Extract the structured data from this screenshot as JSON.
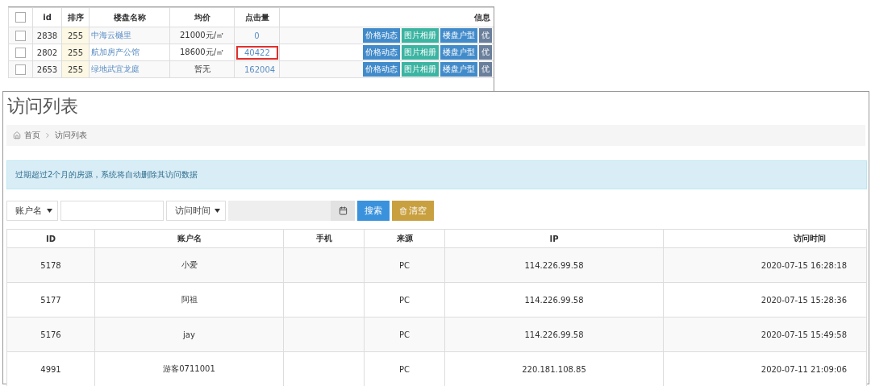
{
  "background_table": {
    "select_all": {
      "checked": false
    },
    "columns": [
      "id",
      "排序",
      "楼盘名称",
      "均价",
      "点击量",
      "信息"
    ],
    "rows": [
      {
        "checked": false,
        "id": "2838",
        "sort": "255",
        "name": "中海云樾里",
        "price": "21000元/㎡",
        "clicks": "0",
        "highlighted": false,
        "actions": [
          {
            "label": "价格动态",
            "color": "#428bca"
          },
          {
            "label": "图片相册",
            "color": "#3cb4a2"
          },
          {
            "label": "楼盘户型",
            "color": "#428bca"
          },
          {
            "label": "优",
            "color": "#6a7f9b"
          }
        ]
      },
      {
        "checked": false,
        "id": "2802",
        "sort": "255",
        "name": "航加房产公馆",
        "price": "18600元/㎡",
        "clicks": "40422",
        "highlighted": true,
        "actions": [
          {
            "label": "价格动态",
            "color": "#428bca"
          },
          {
            "label": "图片相册",
            "color": "#3cb4a2"
          },
          {
            "label": "楼盘户型",
            "color": "#428bca"
          },
          {
            "label": "优",
            "color": "#6a7f9b"
          }
        ]
      },
      {
        "checked": false,
        "id": "2653",
        "sort": "255",
        "name": "绿地武宜龙庭",
        "price": "暂无",
        "clicks": "162004",
        "highlighted": false,
        "actions": [
          {
            "label": "价格动态",
            "color": "#428bca"
          },
          {
            "label": "图片相册",
            "color": "#3cb4a2"
          },
          {
            "label": "楼盘户型",
            "color": "#428bca"
          },
          {
            "label": "优",
            "color": "#6a7f9b"
          }
        ]
      }
    ]
  },
  "page": {
    "title": "访问列表",
    "breadcrumb": [
      {
        "label": "首页",
        "kind": "home"
      },
      {
        "label": "访问列表",
        "kind": "page"
      }
    ],
    "alert": "过期超过2个月的房源，系统将自动删除其访问数据",
    "filters": {
      "field_select": "账户名",
      "time_select": "访问时间"
    },
    "buttons": [
      {
        "label": "搜索",
        "kind": "search"
      },
      {
        "label": "清空",
        "kind": "clear"
      }
    ],
    "table": {
      "columns": [
        "ID",
        "账户名",
        "手机",
        "来源",
        "IP",
        "访问时间"
      ],
      "rows": [
        {
          "id": "5178",
          "account": "小爱",
          "source": "PC",
          "ip": "114.226.99.58",
          "time": "2020-07-15 16:28:18"
        },
        {
          "id": "5177",
          "account": "阿祖",
          "source": "PC",
          "ip": "114.226.99.58",
          "time": "2020-07-15 15:28:36"
        },
        {
          "id": "5176",
          "account": "jay",
          "source": "PC",
          "ip": "114.226.99.58",
          "time": "2020-07-15 15:49:58"
        },
        {
          "id": "4991",
          "account": "游客0711001",
          "source": "PC",
          "ip": "220.181.108.85",
          "time": "2020-07-11 21:09:06"
        }
      ]
    }
  }
}
